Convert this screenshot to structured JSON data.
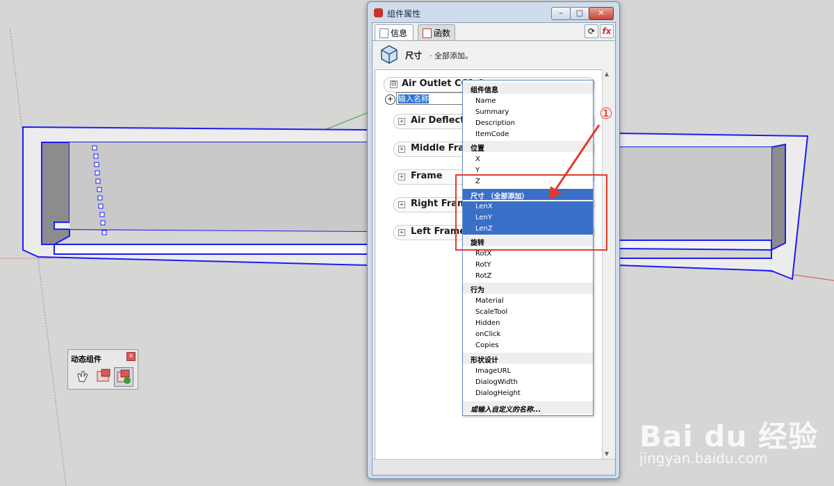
{
  "dialog": {
    "title": "组件属性",
    "tabs": [
      {
        "label": "信息"
      },
      {
        "label": "函数"
      }
    ],
    "header_title": "尺寸",
    "header_sub": "· 全部添加。",
    "window_buttons": {
      "minimize": "–",
      "maximize": "□",
      "close": "✕"
    }
  },
  "components": {
    "top": {
      "name": "Air Outlet CC1-0",
      "expander": "⊟"
    },
    "name_input_value": "输入名称",
    "add_symbol": "+",
    "children": [
      {
        "name": "Air Deflector"
      },
      {
        "name": "Middle Frame"
      },
      {
        "name": "Frame"
      },
      {
        "name": "Right Frame"
      },
      {
        "name": "Left Frame"
      }
    ]
  },
  "dropdown": {
    "groups": [
      {
        "header": "组件信息",
        "items": [
          "Name",
          "Summary",
          "Description",
          "ItemCode"
        ]
      },
      {
        "header": "位置",
        "items": [
          "X",
          "Y",
          "Z"
        ]
      },
      {
        "header": "尺寸 （全部添加）",
        "items": [
          "LenX",
          "LenY",
          "LenZ"
        ]
      },
      {
        "header": "旋转",
        "items": [
          "RotX",
          "RotY",
          "RotZ"
        ]
      },
      {
        "header": "行为",
        "items": [
          "Material",
          "ScaleTool",
          "Hidden",
          "onClick",
          "Copies"
        ]
      },
      {
        "header": "形状设计",
        "items": [
          "ImageURL",
          "DialogWidth",
          "DialogHeight"
        ]
      }
    ],
    "footer": "或输入自定义的名称..."
  },
  "annotation": {
    "callout": "①",
    "color": "#e23b2b"
  },
  "toolbar_widget": {
    "title": "动态组件",
    "close": "x"
  },
  "watermark": {
    "brand": "Bai du 经验",
    "url": "jingyan.baidu.com"
  },
  "colors": {
    "selection": "#3a6fc8",
    "model_outline": "#1b1bf5",
    "dialog_chrome": "#cfdcec"
  }
}
